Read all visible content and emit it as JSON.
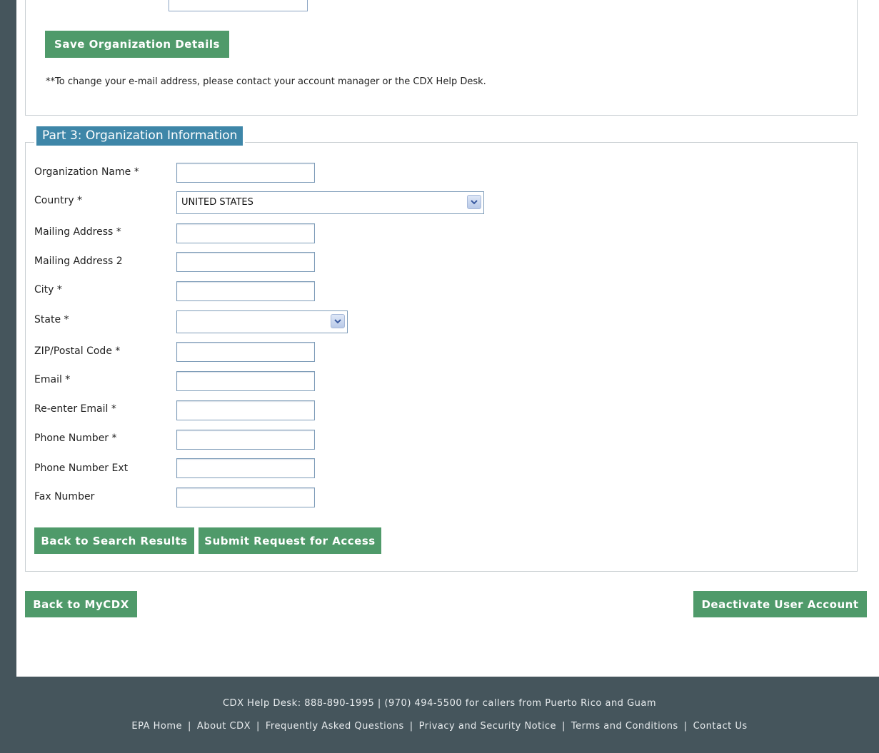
{
  "top_section": {
    "save_button": "Save Organization Details",
    "note": "**To change your e-mail address, please contact your account manager or the CDX Help Desk."
  },
  "part3": {
    "legend": "Part 3: Organization Information",
    "fields": [
      {
        "label": "Organization Name *",
        "value": ""
      },
      {
        "label": "Country *",
        "value": "UNITED STATES"
      },
      {
        "label": "Mailing Address *",
        "value": ""
      },
      {
        "label": "Mailing Address 2",
        "value": ""
      },
      {
        "label": "City *",
        "value": ""
      },
      {
        "label": "State *",
        "value": ""
      },
      {
        "label": "ZIP/Postal Code *",
        "value": ""
      },
      {
        "label": "Email *",
        "value": ""
      },
      {
        "label": "Re-enter Email *",
        "value": ""
      },
      {
        "label": "Phone Number *",
        "value": ""
      },
      {
        "label": "Phone Number Ext",
        "value": ""
      },
      {
        "label": "Fax Number",
        "value": ""
      }
    ],
    "back_button": "Back to Search Results",
    "submit_button": "Submit Request for Access"
  },
  "bottom": {
    "back_mycdx": "Back to MyCDX",
    "deactivate": "Deactivate User Account"
  },
  "footer": {
    "helpdesk": "CDX Help Desk: 888-890-1995 | (970) 494-5500 for callers from Puerto Rico and Guam",
    "links": [
      "EPA Home",
      "About CDX",
      "Frequently Asked Questions",
      "Privacy and Security Notice",
      "Terms and Conditions",
      "Contact Us"
    ]
  },
  "colors": {
    "button": "#4f9a6a",
    "legend": "#3e86a8",
    "frame": "#45555c"
  },
  "icons": {
    "select_arrow": "chevron-down-icon"
  }
}
